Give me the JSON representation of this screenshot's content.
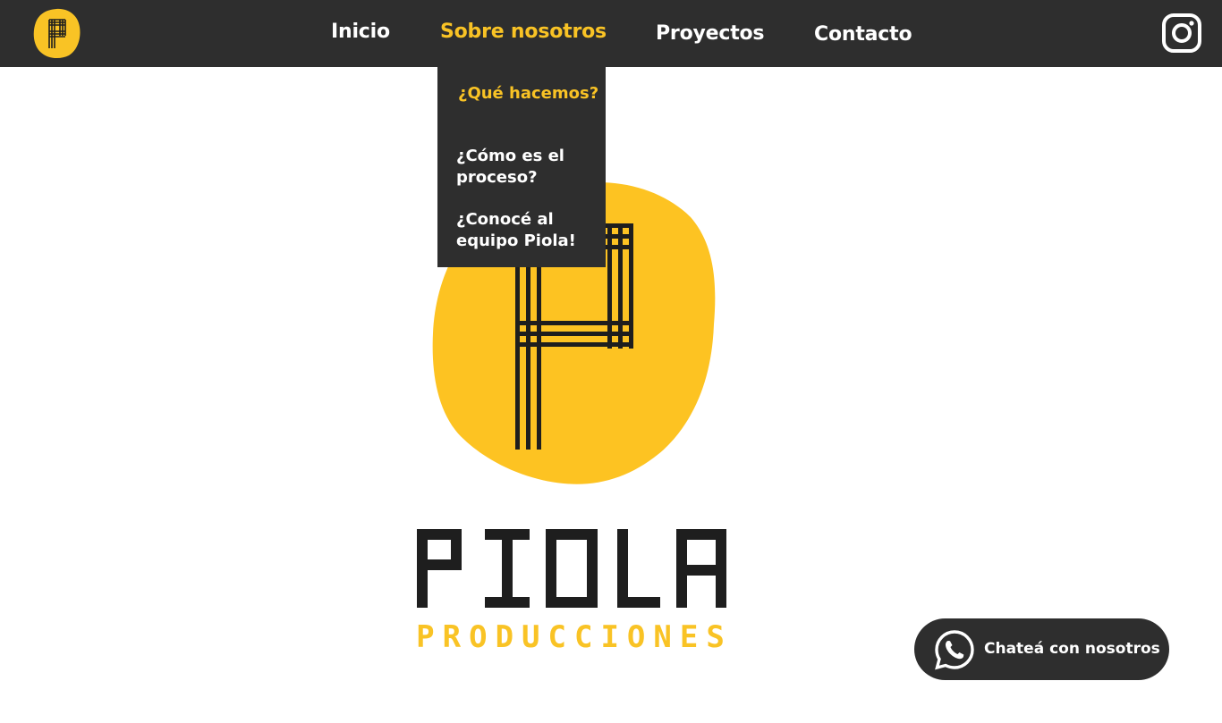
{
  "nav": {
    "logo_icon": "piola-p-logo-icon",
    "links": [
      {
        "label": "Inicio"
      },
      {
        "label": "Sobre nosotros",
        "active": true
      },
      {
        "label": "Proyectos"
      },
      {
        "label": "Contacto"
      }
    ],
    "social_icon": "instagram-icon"
  },
  "dropdown": {
    "items": [
      {
        "label": "¿Qué hacemos?",
        "active": true
      },
      {
        "label": "¿Cómo es el proceso?"
      },
      {
        "label": "¿Conocé al equipo Piola!"
      }
    ]
  },
  "hero": {
    "logo_icon": "piola-p-emblem-icon",
    "brand_name": "PIOLA",
    "brand_sub": "PRODUCCIONES"
  },
  "whatsapp": {
    "icon": "whatsapp-icon",
    "label": "Chateá con nosotros"
  },
  "colors": {
    "bar": "#2e2e2e",
    "accent": "#f9c325",
    "text_light": "#ffffff",
    "ink": "#1e1e1e"
  }
}
